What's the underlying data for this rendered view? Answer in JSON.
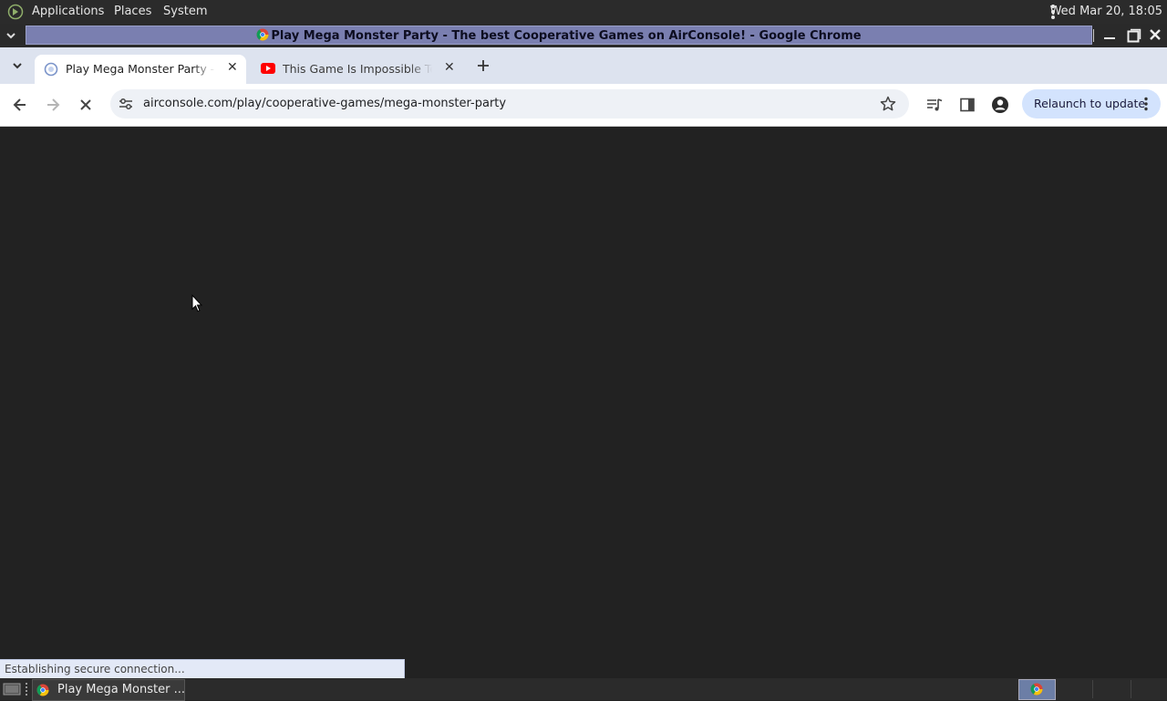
{
  "panel": {
    "menus": [
      "Applications",
      "Places",
      "System"
    ],
    "clock": "Wed Mar 20, 18:05"
  },
  "window": {
    "title": "Play Mega Monster Party - The best Cooperative Games on AirConsole! - Google Chrome"
  },
  "tabs": [
    {
      "label": "Play Mega Monster Party - The best Cooperative Games on AirConsole!",
      "icon": "airconsole-favicon",
      "active": true
    },
    {
      "label": "This Game Is Impossible To Win",
      "icon": "youtube-favicon",
      "active": false
    }
  ],
  "toolbar": {
    "url": "airconsole.com/play/cooperative-games/mega-monster-party",
    "relaunch_label": "Relaunch to update"
  },
  "status_text": "Establishing secure connection...",
  "taskbar": {
    "window_button": "Play Mega Monster ..."
  },
  "colors": {
    "page_background": "#222222",
    "title_strip": "#7a7fb0",
    "tab_strip": "#dde3ef",
    "relaunch_button": "#d3e3fd"
  }
}
